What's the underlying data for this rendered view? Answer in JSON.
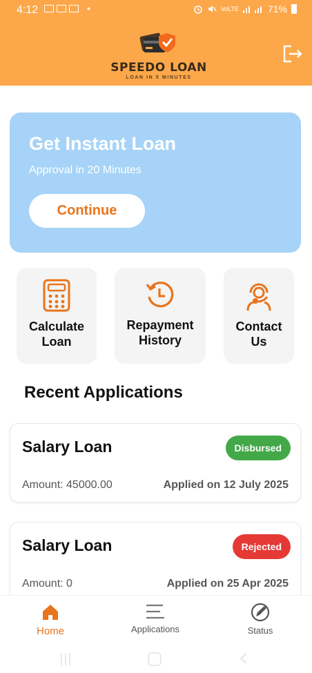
{
  "status": {
    "time": "4:12",
    "dot": "•",
    "network": "VoLTE",
    "battery": "71%"
  },
  "header": {
    "app_name": "SPEEDO LOAN",
    "tagline": "LOAN IN 5 MINUTES"
  },
  "hero": {
    "title": "Get Instant Loan",
    "subtitle": "Approval in 20 Minutes",
    "button": "Continue"
  },
  "quick_actions": [
    {
      "line1": "Calculate",
      "line2": "Loan",
      "icon": "calculator-icon"
    },
    {
      "line1": "Repayment",
      "line2": "History",
      "icon": "history-icon"
    },
    {
      "line1": "Contact",
      "line2": "Us",
      "icon": "support-agent-icon"
    }
  ],
  "recent": {
    "title": "Recent Applications",
    "items": [
      {
        "name": "Salary Loan",
        "status": "Disbursed",
        "status_color": "#43a847",
        "amount": "Amount: 45000.00",
        "applied": "Applied on 12 July 2025"
      },
      {
        "name": "Salary Loan",
        "status": "Rejected",
        "status_color": "#e53935",
        "amount": "Amount: 0",
        "applied": "Applied on 25 Apr 2025"
      }
    ]
  },
  "nav": {
    "home": "Home",
    "applications": "Applications",
    "status": "Status",
    "active_color": "#e8741c"
  },
  "colors": {
    "brand": "#fca84a",
    "accent": "#e8741c",
    "hero_bg": "#a6d3f7"
  }
}
